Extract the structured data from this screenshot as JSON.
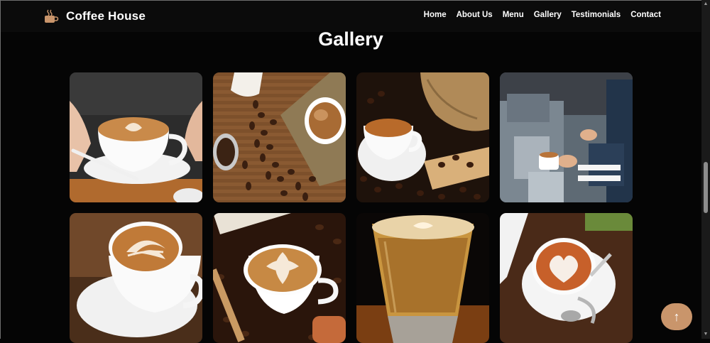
{
  "header": {
    "brand": "Coffee House",
    "brand_icon": "coffee-cup-icon",
    "nav": [
      "Home",
      "About Us",
      "Menu",
      "Gallery",
      "Testimonials",
      "Contact"
    ]
  },
  "main": {
    "title": "Gallery",
    "images": [
      "latte-art-cup-held-image",
      "coffee-beans-sack-and-cup-image",
      "espresso-cup-with-burlap-beans-image",
      "barista-espresso-machine-image",
      "latte-art-saucer-image",
      "latte-art-on-beans-image",
      "iced-coffee-glass-image",
      "heart-latte-on-table-image"
    ]
  },
  "back_to_top": {
    "icon": "arrow-up-icon",
    "label": "↑"
  },
  "colors": {
    "background": "#050505",
    "accent": "#c9956b",
    "text": "#ffffff"
  }
}
